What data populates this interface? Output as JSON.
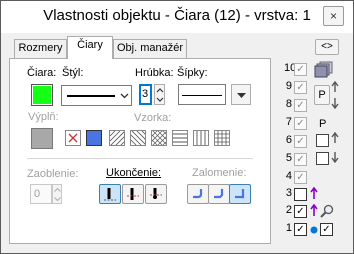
{
  "window": {
    "title": "Vlastnosti objektu - Čiara (12) - vrstva: 1",
    "close_glyph": "×"
  },
  "tabs": [
    "Rozmery",
    "Čiary",
    "Obj. manažér"
  ],
  "arrows_button": "<>",
  "line": {
    "ciara_label": "Čiara:",
    "styl_label": "Štýl:",
    "hrubka_label": "Hrúbka:",
    "sipky_label": "Šípky:",
    "color": "#14ff14",
    "thickness_value": "3",
    "vypln_label": "Výplň:",
    "vzorka_label": "Vzorka:"
  },
  "rounding": {
    "label": "Zaoblenie:",
    "value": "0"
  },
  "ending": {
    "label": "Ukončenie:"
  },
  "joining": {
    "label": "Zalomenie:"
  },
  "layers": {
    "numbers": [
      "10",
      "9",
      "8",
      "7",
      "6",
      "5",
      "4",
      "3",
      "2",
      "1"
    ],
    "p_button": "P",
    "p_label": "P"
  },
  "colors": {
    "accent": "#0078d7",
    "arrow_purple": "#8b00c8",
    "fill_blue": "#4a74e0"
  }
}
